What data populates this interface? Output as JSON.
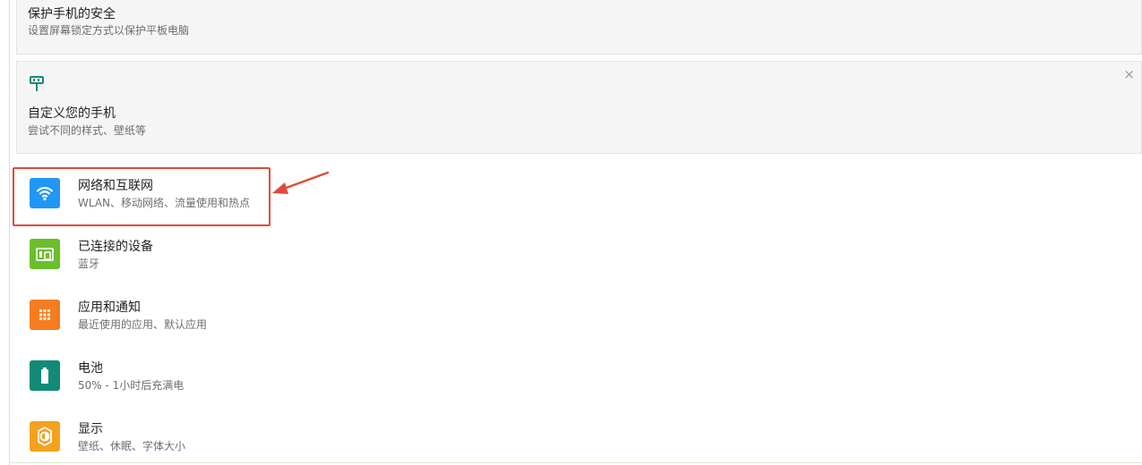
{
  "cards": [
    {
      "title": "保护手机的安全",
      "subtitle": "设置屏幕锁定方式以保护平板电脑"
    },
    {
      "icon": "paint-roller-icon",
      "title": "自定义您的手机",
      "subtitle": "尝试不同的样式、壁纸等",
      "close_glyph": "×"
    }
  ],
  "settings": [
    {
      "icon": "wifi-icon",
      "icon_color": "#2196f3",
      "title": "网络和互联网",
      "subtitle": "WLAN、移动网络、流量使用和热点"
    },
    {
      "icon": "connected-devices-icon",
      "icon_color": "#6abf2b",
      "title": "已连接的设备",
      "subtitle": "蓝牙"
    },
    {
      "icon": "apps-grid-icon",
      "icon_color": "#f57c1f",
      "title": "应用和通知",
      "subtitle": "最近使用的应用、默认应用"
    },
    {
      "icon": "battery-icon",
      "icon_color": "#138a78",
      "title": "电池",
      "subtitle": "50% - 1小时后充满电"
    },
    {
      "icon": "display-brightness-icon",
      "icon_color": "#f4a21d",
      "title": "显示",
      "subtitle": "壁纸、休眠、字体大小"
    }
  ],
  "annotation": {
    "highlight_color": "#e04a3b"
  }
}
